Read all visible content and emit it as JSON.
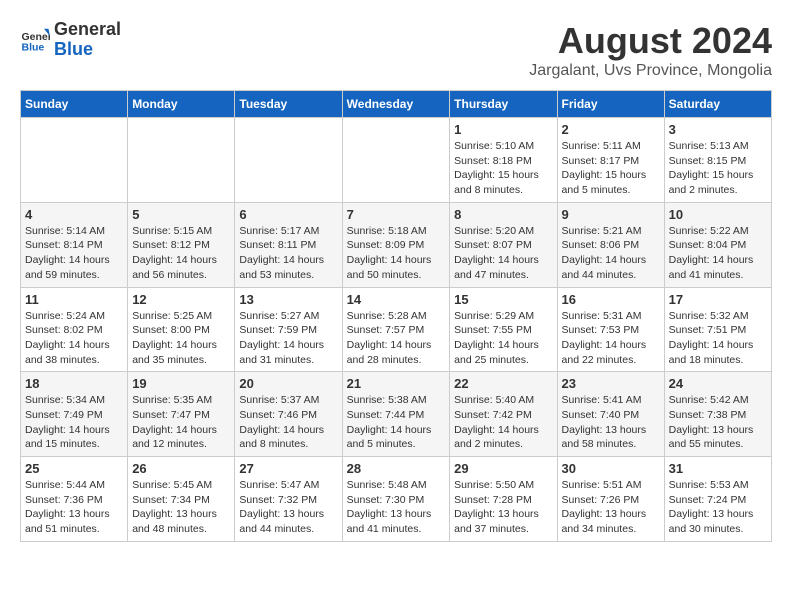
{
  "header": {
    "logo_general": "General",
    "logo_blue": "Blue",
    "month_year": "August 2024",
    "location": "Jargalant, Uvs Province, Mongolia"
  },
  "calendar": {
    "days_of_week": [
      "Sunday",
      "Monday",
      "Tuesday",
      "Wednesday",
      "Thursday",
      "Friday",
      "Saturday"
    ],
    "weeks": [
      [
        {
          "day": "",
          "info": ""
        },
        {
          "day": "",
          "info": ""
        },
        {
          "day": "",
          "info": ""
        },
        {
          "day": "",
          "info": ""
        },
        {
          "day": "1",
          "info": "Sunrise: 5:10 AM\nSunset: 8:18 PM\nDaylight: 15 hours\nand 8 minutes."
        },
        {
          "day": "2",
          "info": "Sunrise: 5:11 AM\nSunset: 8:17 PM\nDaylight: 15 hours\nand 5 minutes."
        },
        {
          "day": "3",
          "info": "Sunrise: 5:13 AM\nSunset: 8:15 PM\nDaylight: 15 hours\nand 2 minutes."
        }
      ],
      [
        {
          "day": "4",
          "info": "Sunrise: 5:14 AM\nSunset: 8:14 PM\nDaylight: 14 hours\nand 59 minutes."
        },
        {
          "day": "5",
          "info": "Sunrise: 5:15 AM\nSunset: 8:12 PM\nDaylight: 14 hours\nand 56 minutes."
        },
        {
          "day": "6",
          "info": "Sunrise: 5:17 AM\nSunset: 8:11 PM\nDaylight: 14 hours\nand 53 minutes."
        },
        {
          "day": "7",
          "info": "Sunrise: 5:18 AM\nSunset: 8:09 PM\nDaylight: 14 hours\nand 50 minutes."
        },
        {
          "day": "8",
          "info": "Sunrise: 5:20 AM\nSunset: 8:07 PM\nDaylight: 14 hours\nand 47 minutes."
        },
        {
          "day": "9",
          "info": "Sunrise: 5:21 AM\nSunset: 8:06 PM\nDaylight: 14 hours\nand 44 minutes."
        },
        {
          "day": "10",
          "info": "Sunrise: 5:22 AM\nSunset: 8:04 PM\nDaylight: 14 hours\nand 41 minutes."
        }
      ],
      [
        {
          "day": "11",
          "info": "Sunrise: 5:24 AM\nSunset: 8:02 PM\nDaylight: 14 hours\nand 38 minutes."
        },
        {
          "day": "12",
          "info": "Sunrise: 5:25 AM\nSunset: 8:00 PM\nDaylight: 14 hours\nand 35 minutes."
        },
        {
          "day": "13",
          "info": "Sunrise: 5:27 AM\nSunset: 7:59 PM\nDaylight: 14 hours\nand 31 minutes."
        },
        {
          "day": "14",
          "info": "Sunrise: 5:28 AM\nSunset: 7:57 PM\nDaylight: 14 hours\nand 28 minutes."
        },
        {
          "day": "15",
          "info": "Sunrise: 5:29 AM\nSunset: 7:55 PM\nDaylight: 14 hours\nand 25 minutes."
        },
        {
          "day": "16",
          "info": "Sunrise: 5:31 AM\nSunset: 7:53 PM\nDaylight: 14 hours\nand 22 minutes."
        },
        {
          "day": "17",
          "info": "Sunrise: 5:32 AM\nSunset: 7:51 PM\nDaylight: 14 hours\nand 18 minutes."
        }
      ],
      [
        {
          "day": "18",
          "info": "Sunrise: 5:34 AM\nSunset: 7:49 PM\nDaylight: 14 hours\nand 15 minutes."
        },
        {
          "day": "19",
          "info": "Sunrise: 5:35 AM\nSunset: 7:47 PM\nDaylight: 14 hours\nand 12 minutes."
        },
        {
          "day": "20",
          "info": "Sunrise: 5:37 AM\nSunset: 7:46 PM\nDaylight: 14 hours\nand 8 minutes."
        },
        {
          "day": "21",
          "info": "Sunrise: 5:38 AM\nSunset: 7:44 PM\nDaylight: 14 hours\nand 5 minutes."
        },
        {
          "day": "22",
          "info": "Sunrise: 5:40 AM\nSunset: 7:42 PM\nDaylight: 14 hours\nand 2 minutes."
        },
        {
          "day": "23",
          "info": "Sunrise: 5:41 AM\nSunset: 7:40 PM\nDaylight: 13 hours\nand 58 minutes."
        },
        {
          "day": "24",
          "info": "Sunrise: 5:42 AM\nSunset: 7:38 PM\nDaylight: 13 hours\nand 55 minutes."
        }
      ],
      [
        {
          "day": "25",
          "info": "Sunrise: 5:44 AM\nSunset: 7:36 PM\nDaylight: 13 hours\nand 51 minutes."
        },
        {
          "day": "26",
          "info": "Sunrise: 5:45 AM\nSunset: 7:34 PM\nDaylight: 13 hours\nand 48 minutes."
        },
        {
          "day": "27",
          "info": "Sunrise: 5:47 AM\nSunset: 7:32 PM\nDaylight: 13 hours\nand 44 minutes."
        },
        {
          "day": "28",
          "info": "Sunrise: 5:48 AM\nSunset: 7:30 PM\nDaylight: 13 hours\nand 41 minutes."
        },
        {
          "day": "29",
          "info": "Sunrise: 5:50 AM\nSunset: 7:28 PM\nDaylight: 13 hours\nand 37 minutes."
        },
        {
          "day": "30",
          "info": "Sunrise: 5:51 AM\nSunset: 7:26 PM\nDaylight: 13 hours\nand 34 minutes."
        },
        {
          "day": "31",
          "info": "Sunrise: 5:53 AM\nSunset: 7:24 PM\nDaylight: 13 hours\nand 30 minutes."
        }
      ]
    ]
  }
}
